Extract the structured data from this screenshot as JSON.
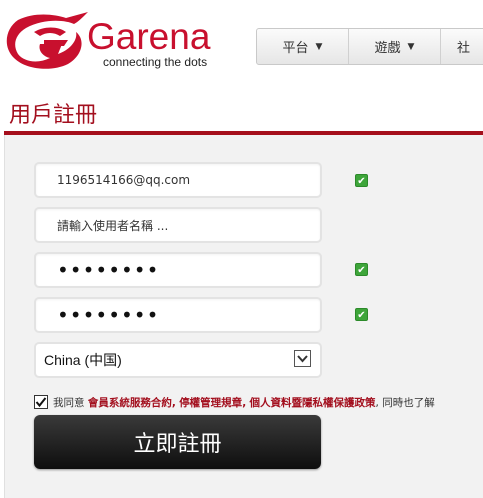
{
  "brand": {
    "name": "Garena",
    "tagline": "connecting the dots",
    "color": "#c8102e"
  },
  "nav": {
    "items": [
      {
        "label": "平台",
        "icon": "caret-down-icon"
      },
      {
        "label": "遊戲",
        "icon": "caret-down-icon"
      },
      {
        "label": "社"
      }
    ]
  },
  "page": {
    "title": "用戶註冊",
    "accent_color": "#a50f1c"
  },
  "form": {
    "email_value": "1196514166@qq.com",
    "email_valid": true,
    "username_placeholder": "請輸入使用者名稱 ...",
    "password_value": "••••••••",
    "password_valid": true,
    "confirm_password_value": "••••••••",
    "confirm_password_valid": true,
    "country_selected": "China (中国)"
  },
  "agreement": {
    "checked": true,
    "prefix": "我同意",
    "terms_link": "會員系統服務合約",
    "sep1": ",",
    "rules_link": "停權管理規章",
    "sep2": ",",
    "privacy_link": "個人資料暨隱私權保護政策",
    "suffix": ", 同時也了解"
  },
  "submit_label": "立即註冊"
}
